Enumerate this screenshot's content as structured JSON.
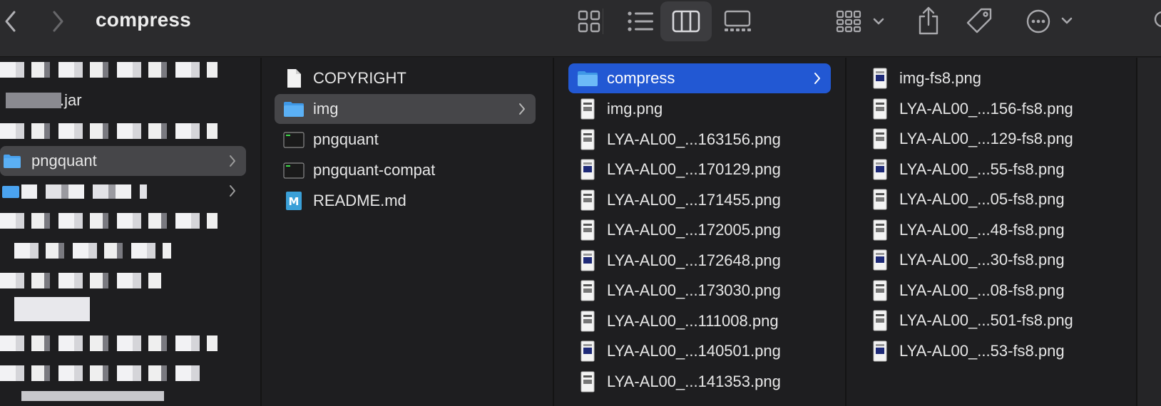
{
  "window": {
    "title": "compress"
  },
  "toolbar": {
    "icons": [
      "chevron-left",
      "chevron-right",
      "icon-view",
      "list-view",
      "column-view",
      "gallery-view",
      "group-by",
      "share",
      "tag",
      "more-actions"
    ]
  },
  "sidebar": {
    "items": [
      {
        "label": ".jar"
      },
      {
        "label": "pngquant"
      }
    ]
  },
  "column2": {
    "items": [
      {
        "name": "COPYRIGHT",
        "icon": "document"
      },
      {
        "name": "img",
        "icon": "folder"
      },
      {
        "name": "pngquant",
        "icon": "terminal"
      },
      {
        "name": "pngquant-compat",
        "icon": "terminal"
      },
      {
        "name": "README.md",
        "icon": "markdown"
      }
    ]
  },
  "column3": {
    "items": [
      {
        "name": "compress",
        "icon": "folder"
      },
      {
        "name": "img.png",
        "icon": "image"
      },
      {
        "name": "LYA-AL00_...163156.png",
        "icon": "image"
      },
      {
        "name": "LYA-AL00_...170129.png",
        "icon": "image"
      },
      {
        "name": "LYA-AL00_...171455.png",
        "icon": "image"
      },
      {
        "name": "LYA-AL00_...172005.png",
        "icon": "image"
      },
      {
        "name": "LYA-AL00_...172648.png",
        "icon": "image"
      },
      {
        "name": "LYA-AL00_...173030.png",
        "icon": "image"
      },
      {
        "name": "LYA-AL00_...111008.png",
        "icon": "image"
      },
      {
        "name": "LYA-AL00_...140501.png",
        "icon": "image"
      },
      {
        "name": "LYA-AL00_...141353.png",
        "icon": "image"
      }
    ]
  },
  "column4": {
    "items": [
      {
        "name": "img-fs8.png",
        "icon": "image"
      },
      {
        "name": "LYA-AL00_...156-fs8.png",
        "icon": "image"
      },
      {
        "name": "LYA-AL00_...129-fs8.png",
        "icon": "image"
      },
      {
        "name": "LYA-AL00_...55-fs8.png",
        "icon": "image"
      },
      {
        "name": "LYA-AL00_...05-fs8.png",
        "icon": "image"
      },
      {
        "name": "LYA-AL00_...48-fs8.png",
        "icon": "image"
      },
      {
        "name": "LYA-AL00_...30-fs8.png",
        "icon": "image"
      },
      {
        "name": "LYA-AL00_...08-fs8.png",
        "icon": "image"
      },
      {
        "name": "LYA-AL00_...501-fs8.png",
        "icon": "image"
      },
      {
        "name": "LYA-AL00_...53-fs8.png",
        "icon": "image"
      }
    ]
  },
  "colors": {
    "selection_blue": "#2258d3",
    "selection_gray": "#464649",
    "folder_blue": "#4aa3f0",
    "background": "#1e1e20",
    "toolbar": "#2b2b2d"
  }
}
